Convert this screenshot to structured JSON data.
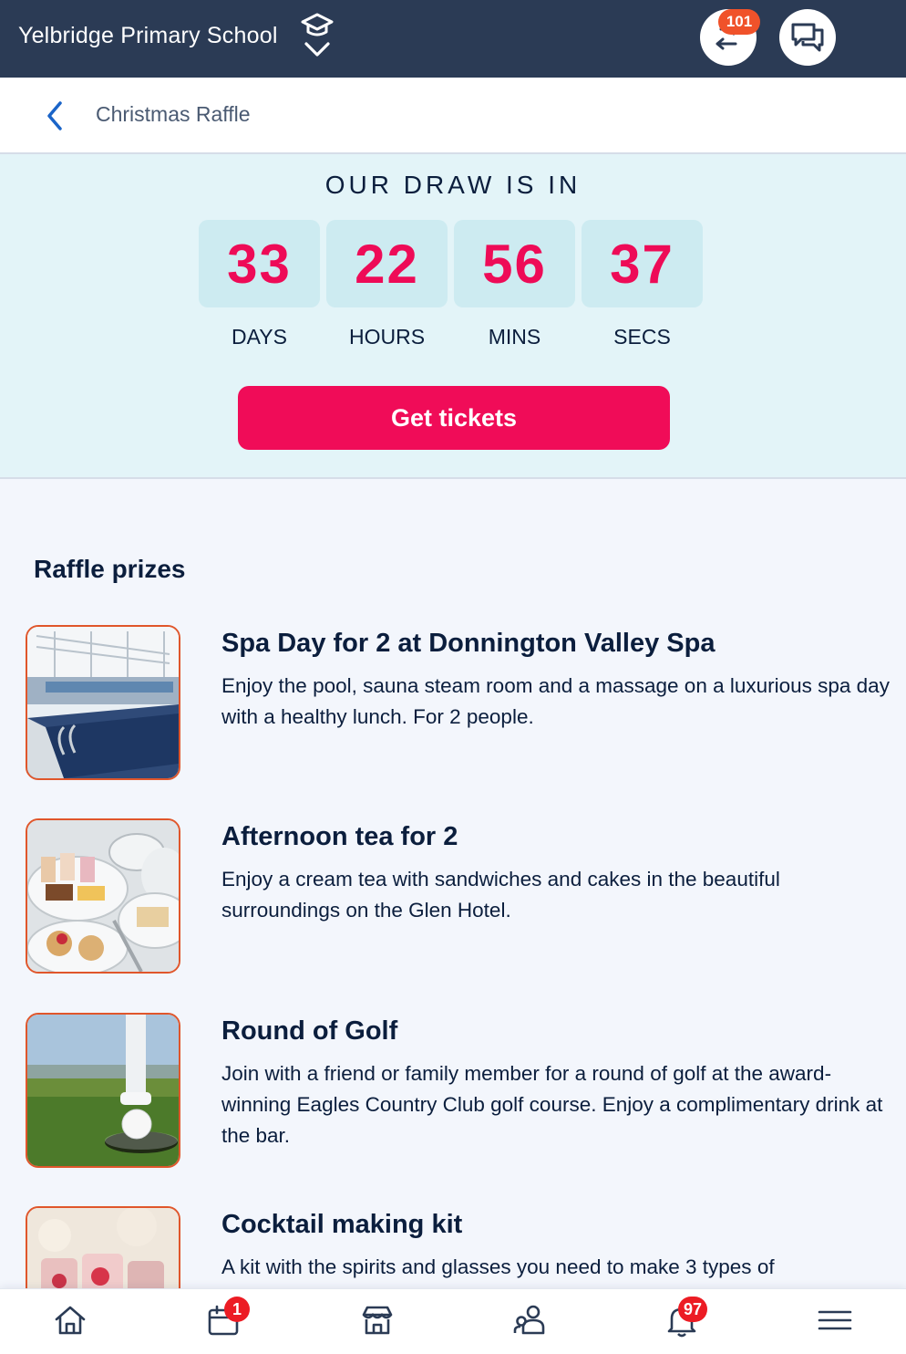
{
  "header": {
    "school_name": "Yelbridge Primary School",
    "transfers_badge": "101",
    "colors": {
      "bar": "#2b3b55",
      "badge": "#f0522a"
    }
  },
  "subheader": {
    "title": "Christmas Raffle"
  },
  "countdown": {
    "heading": "OUR DRAW IS IN",
    "units": [
      {
        "value": "33",
        "label": "DAYS"
      },
      {
        "value": "22",
        "label": "HOURS"
      },
      {
        "value": "56",
        "label": "MINS"
      },
      {
        "value": "37",
        "label": "SECS"
      }
    ],
    "button_label": "Get tickets",
    "colors": {
      "panel": "#e3f4f8",
      "digits": "#ee0b57",
      "button": "#f00c58"
    }
  },
  "prizes": {
    "title": "Raffle prizes",
    "items": [
      {
        "name": "Spa Day for 2 at Donnington Valley Spa",
        "description": "Enjoy the pool, sauna steam room and a massage on a luxurious spa day with a healthy lunch. For 2 people.",
        "image": "spa-pool-photo"
      },
      {
        "name": "Afternoon tea for 2",
        "description": "Enjoy a cream tea with sandwiches and cakes in the beautiful surroundings on the Glen Hotel.",
        "image": "afternoon-tea-photo"
      },
      {
        "name": "Round of Golf",
        "description": "Join with a friend or family member for a round of golf at the award-winning Eagles Country Club golf course. Enjoy a complimentary drink at the bar.",
        "image": "golf-photo"
      },
      {
        "name": "Cocktail making kit",
        "description": "A kit with the spirits and glasses you need to make 3 types of",
        "image": "cocktail-photo"
      }
    ]
  },
  "bottom_nav": {
    "items": [
      {
        "icon": "home-icon"
      },
      {
        "icon": "calendar-icon",
        "badge": "1"
      },
      {
        "icon": "shop-icon"
      },
      {
        "icon": "people-icon"
      },
      {
        "icon": "bell-icon",
        "badge": "97"
      },
      {
        "icon": "menu-icon"
      }
    ]
  }
}
